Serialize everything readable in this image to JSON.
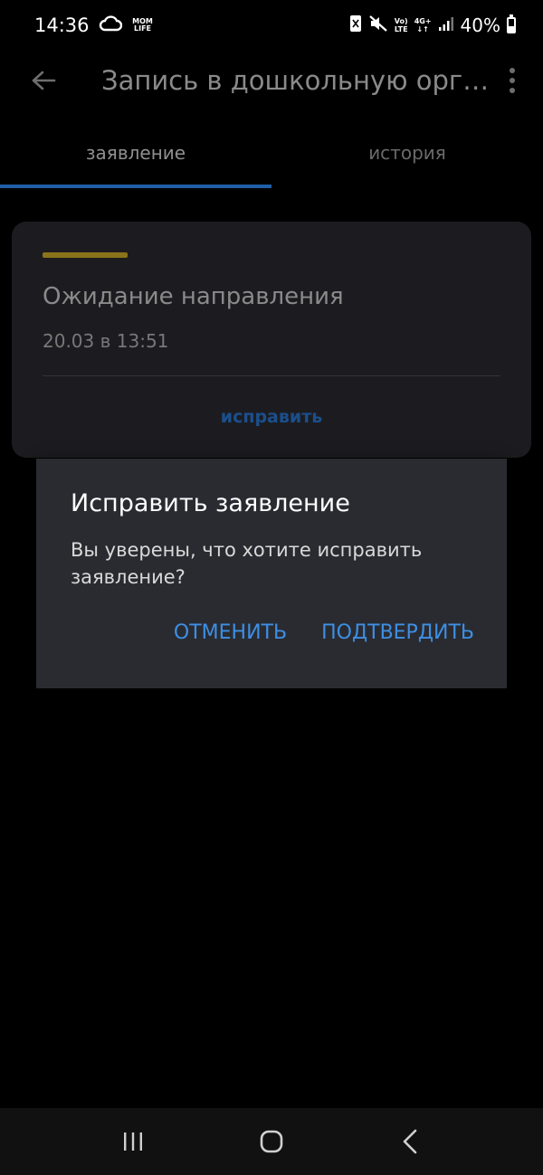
{
  "status_bar": {
    "time": "14:36",
    "app_badge_line1": "MOM",
    "app_badge_line2": "LIFE",
    "volte_line1": "Vo)",
    "volte_line2": "LTE",
    "net_line1": "4G+",
    "net_line2": "↓↑",
    "battery_text": "40%",
    "battery_level": 0.4
  },
  "app_bar": {
    "title": "Запись в дошкольную орга…",
    "back_icon": "arrow-left-icon",
    "more_icon": "more-vertical-icon"
  },
  "tabs": [
    {
      "label": "заявление",
      "active": true
    },
    {
      "label": "история",
      "active": false
    }
  ],
  "card": {
    "status": "Ожидание направления",
    "date": "20.03 в 13:51",
    "action": "исправить",
    "accent_color": "#8b7319"
  },
  "dialog": {
    "title": "Исправить заявление",
    "message": "Вы уверены, что хотите исправить заявление?",
    "cancel": "ОТМЕНИТЬ",
    "confirm": "ПОДТВЕРДИТЬ",
    "accent_color": "#3d8fe3"
  },
  "nav_bar": {
    "recents_icon": "recents-icon",
    "home_icon": "home-icon",
    "back_icon": "back-chevron-icon"
  }
}
